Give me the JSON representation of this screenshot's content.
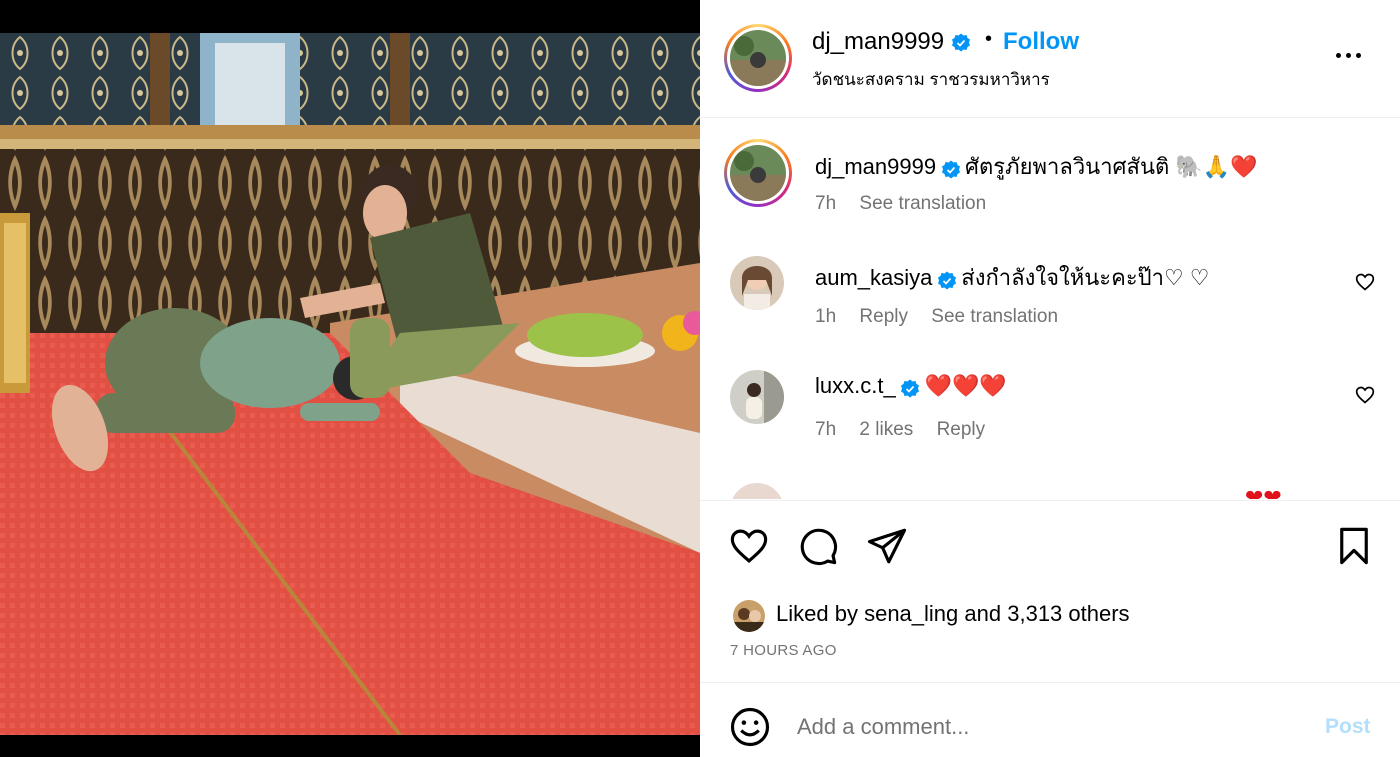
{
  "post": {
    "author": "dj_man9999",
    "follow_label": "Follow",
    "separator": "•",
    "location": "วัดชนะสงคราม ราชวรมหาวิหาร"
  },
  "comments": [
    {
      "username": "dj_man9999",
      "verified": true,
      "text": "ศัตรูภัยพาลวินาศสันติ 🐘🙏❤️",
      "time": "7h",
      "links": [
        "See translation"
      ]
    },
    {
      "username": "aum_kasiya",
      "verified": true,
      "text": "ส่งกำลังใจให้นะคะป๊า♡ ♡",
      "time": "1h",
      "links": [
        "Reply",
        "See translation"
      ]
    },
    {
      "username": "luxx.c.t_",
      "verified": true,
      "text": "❤️❤️❤️",
      "time": "7h",
      "likes": "2 likes",
      "links": [
        "Reply"
      ]
    }
  ],
  "likes": {
    "prefix": "Liked by",
    "user": "sena_ling",
    "middle": "and",
    "count": "3,313 others"
  },
  "timestamp": "7 HOURS AGO",
  "add_comment": {
    "placeholder": "Add a comment...",
    "post_label": "Post"
  },
  "colors": {
    "accent": "#0095f6",
    "muted": "#737373",
    "post_disabled": "#b2dffc",
    "heart_red": "#e0121b"
  },
  "icons": [
    "verified-badge-icon",
    "more-options-icon",
    "like-icon",
    "comment-icon",
    "share-icon",
    "save-icon",
    "emoji-icon",
    "heart-small-icon"
  ]
}
